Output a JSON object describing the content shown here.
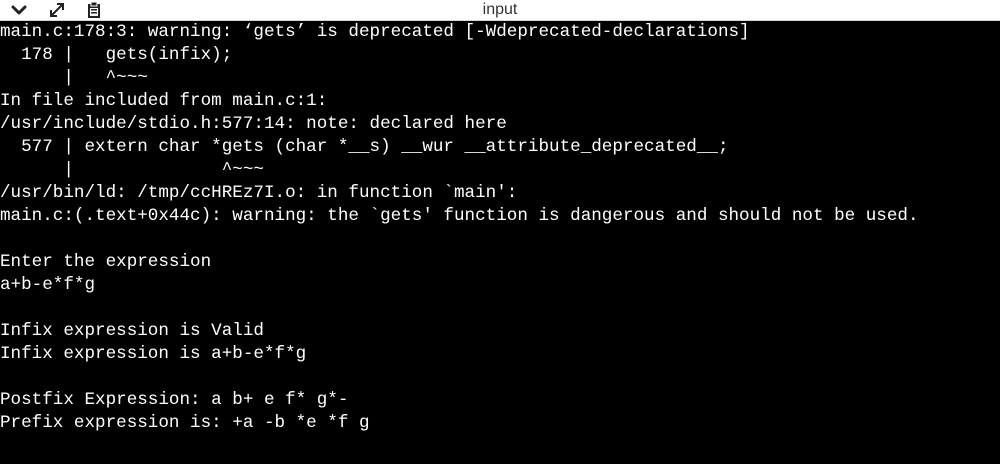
{
  "titlebar": {
    "title": "input",
    "icons": [
      "chevron-down-icon",
      "expand-icon",
      "clipboard-icon"
    ]
  },
  "terminal": {
    "lines": [
      "main.c:178:3: warning: ‘gets’ is deprecated [-Wdeprecated-declarations]",
      "  178 |   gets(infix);",
      "      |   ^~~~",
      "In file included from main.c:1:",
      "/usr/include/stdio.h:577:14: note: declared here",
      "  577 | extern char *gets (char *__s) __wur __attribute_deprecated__;",
      "      |              ^~~~",
      "/usr/bin/ld: /tmp/ccHREz7I.o: in function `main':",
      "main.c:(.text+0x44c): warning: the `gets' function is dangerous and should not be used.",
      "",
      "Enter the expression",
      "a+b-e*f*g",
      "",
      "Infix expression is Valid",
      "Infix expression is a+b-e*f*g",
      "",
      "Postfix Expression: a b+ e f* g*-",
      "Prefix expression is: +a -b *e *f g"
    ]
  }
}
